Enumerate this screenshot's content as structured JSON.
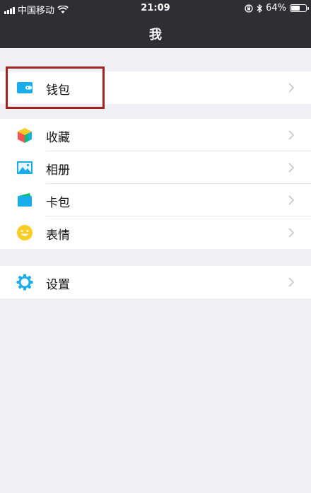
{
  "status_bar": {
    "carrier": "中国移动",
    "time": "21:09",
    "battery_percent": "64%",
    "battery_level": 0.64
  },
  "nav": {
    "title": "我"
  },
  "menu": {
    "wallet": "钱包",
    "favorites": "收藏",
    "album": "相册",
    "cards": "卡包",
    "stickers": "表情",
    "settings": "设置"
  },
  "icons": {
    "wallet": "wallet-icon",
    "favorites": "cube-icon",
    "album": "photo-icon",
    "cards": "card-icon",
    "stickers": "smiley-icon",
    "settings": "gear-icon",
    "chevron": "chevron-right-icon"
  },
  "colors": {
    "nav_background": "#2f2f33",
    "page_background": "#efeff4",
    "highlight_border": "#a4221f",
    "icon_blue": "#1aadeb",
    "icon_yellow": "#fbcc23"
  }
}
